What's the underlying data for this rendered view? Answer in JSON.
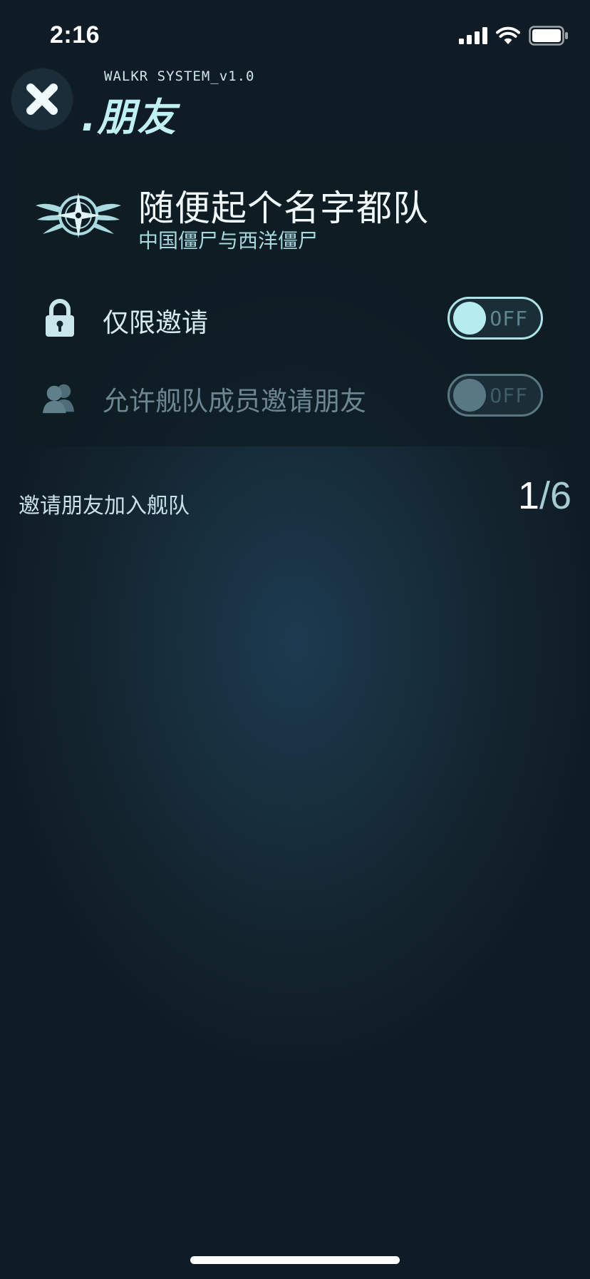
{
  "status_bar": {
    "time": "2:16",
    "icons": [
      "signal-icon",
      "wifi-icon",
      "battery-icon"
    ]
  },
  "header": {
    "system_label": "WALKR SYSTEM_v1.0",
    "title": ".朋友",
    "close_icon": "close-icon"
  },
  "fleet": {
    "name": "随便起个名字都队",
    "subtitle": "中国僵尸与西洋僵尸",
    "emblem_icon": "winged-compass-emblem"
  },
  "settings": [
    {
      "label": "仅限邀请",
      "icon": "lock-icon",
      "toggle_text": "OFF",
      "on": false,
      "enabled": true
    },
    {
      "label": "允许舰队成员邀请朋友",
      "icon": "members-icon",
      "toggle_text": "OFF",
      "on": false,
      "enabled": false
    }
  ],
  "invite": {
    "label": "邀请朋友加入舰队",
    "current": "1",
    "total": "/6"
  },
  "colors": {
    "accent": "#bff0f4",
    "toggle_border": "#aee4e8",
    "card_bg": "#0e1c24",
    "background": "#13242f"
  }
}
